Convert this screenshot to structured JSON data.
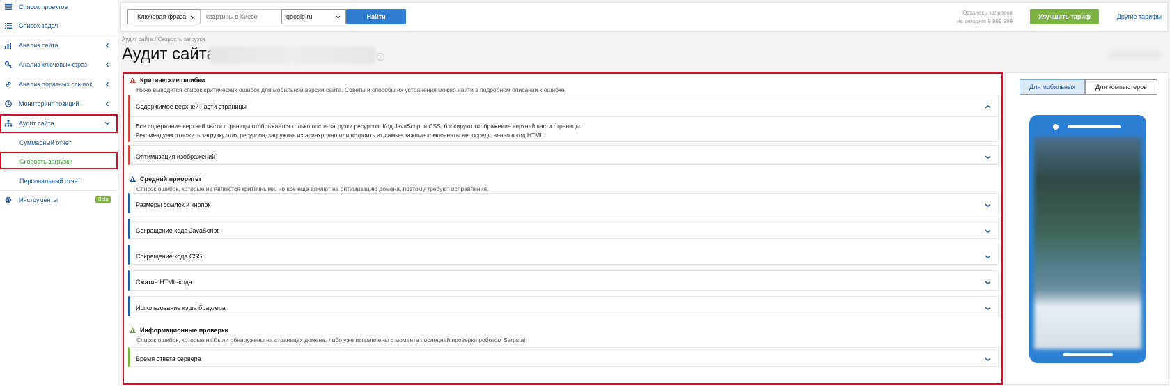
{
  "sidebar": {
    "items": [
      {
        "label": "Список проектов",
        "icon": "menu-icon"
      },
      {
        "label": "Список задач",
        "icon": "list-icon"
      },
      {
        "label": "Анализ сайта",
        "icon": "chart-icon"
      },
      {
        "label": "Анализ ключевых фраз",
        "icon": "key-icon"
      },
      {
        "label": "Анализ обратных ссылок",
        "icon": "link-icon"
      },
      {
        "label": "Мониторинг позиций",
        "icon": "history-icon"
      },
      {
        "label": "Аудит сайта",
        "icon": "sitemap-icon"
      }
    ],
    "subitems": [
      "Суммарный отчет",
      "Скорость загрузки",
      "Персональный отчет"
    ],
    "tools": {
      "label": "Инструменты",
      "icon": "gear-icon",
      "badge": "Beta"
    }
  },
  "header": {
    "search_type": "Ключевая фраза",
    "search_placeholder": "квартиры в Киеве",
    "database": "google.ru",
    "find_label": "Найти",
    "quota_line1": "Осталось запросов",
    "quota_line2": "на сегодня: 9 999 999",
    "upgrade_label": "Улучшить тариф",
    "other_tariffs_label": "Другие тарифы"
  },
  "page": {
    "breadcrumb": "Аудит сайта / Скорость загрузки",
    "title": "Аудит сайта"
  },
  "critical": {
    "title": "Критические ошибки",
    "desc": "Ниже выводится список критических ошибок для мобильной версии сайта. Советы и способы их устранения можно найти в подробном описании к ошибке",
    "items": [
      {
        "title": "Содержимое верхней части страницы",
        "body1": "Все содержание верхней части страницы отображается только после загрузки ресурсов. Код JavaScript и CSS, блокируют отображение верхней части страницы.",
        "body2": "Рекомендуем отложить загрузку этих ресурсов, загружать их асинхронно или встроить их самые важные компоненты непосредственно в код HTML."
      },
      {
        "title": "Оптимизация изображений"
      }
    ]
  },
  "medium": {
    "title": "Средний приоритет",
    "desc": "Список ошибок, которые не являются критичными, но все еще влияют на оптимизацию домена, поэтому требуют исправления.",
    "items": [
      {
        "title": "Размеры ссылок и кнопок"
      },
      {
        "title": "Сокращение кода JavaScript"
      },
      {
        "title": "Сокращение кода CSS"
      },
      {
        "title": "Сжатие HTML-кода"
      },
      {
        "title": "Использование кэша браузера"
      }
    ]
  },
  "info": {
    "title": "Информационные проверки",
    "desc": "Список ошибок, которые не были обнаружены на страницах домена, либо уже исправлены с момента последней проверки роботом Serpstat",
    "items": [
      {
        "title": "Время ответа сервера"
      }
    ]
  },
  "preview": {
    "tab_mobile": "Для мобильных",
    "tab_desktop": "Для компьютеров"
  },
  "colors": {
    "accent": "#2e7dd1",
    "link": "#1a57a8",
    "critical": "#d04444",
    "medium": "#1f5a9e",
    "info": "#7cb342",
    "highlight": "#d0112b"
  }
}
